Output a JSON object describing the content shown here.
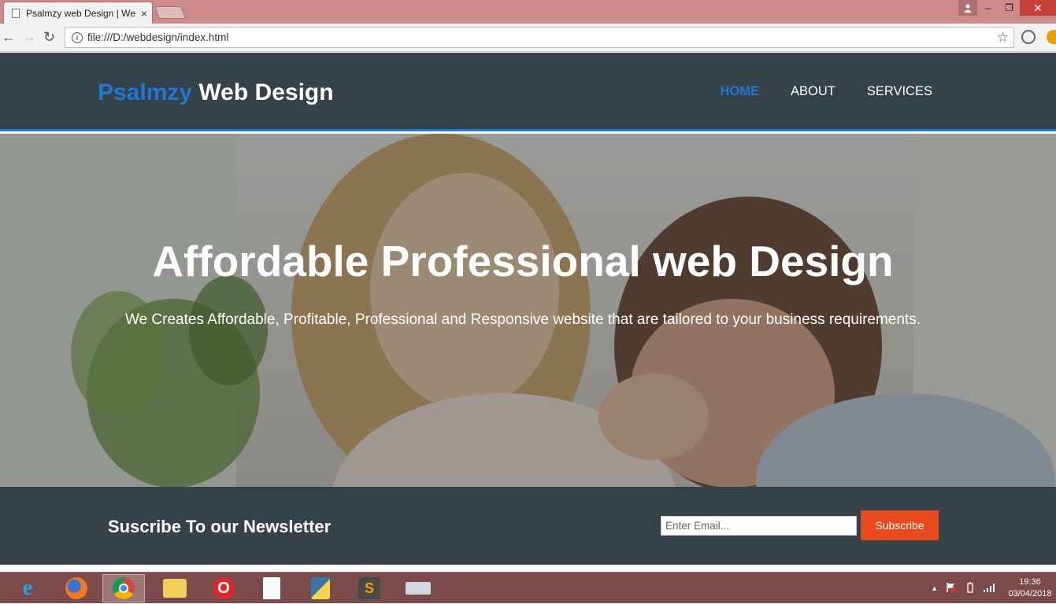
{
  "browser": {
    "tab_title": "Psalmzy web Design | We",
    "tab_close": "×",
    "url": "file:///D:/webdesign/index.html",
    "info": "i",
    "star": "☆",
    "back": "←",
    "forward": "→",
    "reload": "↻",
    "win_min": "–",
    "win_max": "❐",
    "win_close": "✕"
  },
  "site": {
    "logo_highlight": "Psalmzy",
    "logo_rest": " Web Design",
    "nav": [
      {
        "label": "HOME"
      },
      {
        "label": "ABOUT"
      },
      {
        "label": "SERVICES"
      }
    ],
    "hero": {
      "title": "Affordable Professional web Design",
      "subtitle": "We Creates Affordable, Profitable, Professional and Responsive website that are tailored to your business requirements."
    },
    "newsletter": {
      "title": "Suscribe To our Newsletter",
      "placeholder": "Enter Email...",
      "button": "Subscribe"
    },
    "colors": {
      "header_bg": "#35424a",
      "accent": "#1f78d1",
      "button": "#e8491d"
    }
  },
  "taskbar": {
    "apps": [
      {
        "name": "internet-explorer-icon",
        "glyph": "e"
      },
      {
        "name": "firefox-icon",
        "glyph": ""
      },
      {
        "name": "chrome-icon",
        "glyph": ""
      },
      {
        "name": "file-explorer-icon",
        "glyph": ""
      },
      {
        "name": "opera-icon",
        "glyph": "O"
      },
      {
        "name": "notepad-icon",
        "glyph": ""
      },
      {
        "name": "python-icon",
        "glyph": ""
      },
      {
        "name": "sublime-text-icon",
        "glyph": "S"
      },
      {
        "name": "keyboard-icon",
        "glyph": ""
      }
    ],
    "tray_arrow": "▲",
    "time": "19:36",
    "date": "03/04/2018"
  }
}
